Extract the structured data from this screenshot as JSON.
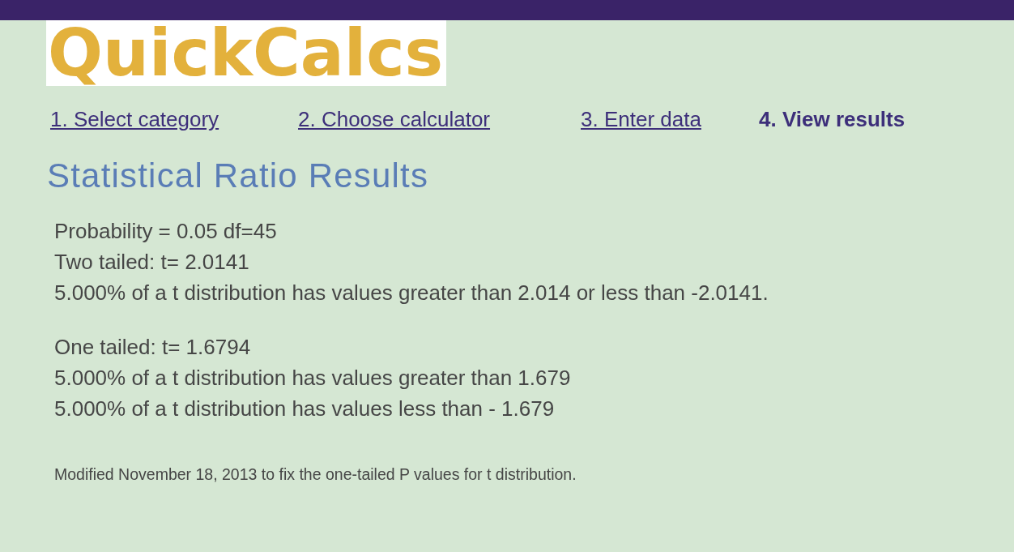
{
  "logo": {
    "text": "QuickCalcs"
  },
  "steps": [
    {
      "label": "1. Select category",
      "selected": false
    },
    {
      "label": "2. Choose calculator",
      "selected": false
    },
    {
      "label": "3. Enter data",
      "selected": false
    },
    {
      "label": "4. View results",
      "selected": true
    }
  ],
  "title": "Statistical Ratio Results",
  "results": [
    {
      "lines": [
        "Probability = 0.05 df=45",
        "Two tailed: t= 2.0141",
        "5.000% of a t distribution has values greater than 2.014 or less than -2.0141."
      ]
    },
    {
      "lines": [
        "One tailed: t= 1.6794",
        "5.000% of a t distribution has values greater than 1.679",
        "5.000% of a t distribution has values less than - 1.679"
      ]
    }
  ],
  "note": "Modified November 18, 2013 to fix the one-tailed P values for t distribution."
}
